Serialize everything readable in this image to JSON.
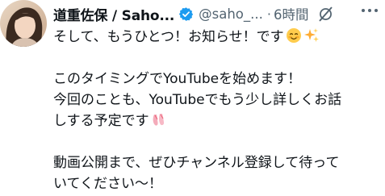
{
  "tweet": {
    "author": {
      "display_name": "道重佐保 / Saho...",
      "handle": "@saho_...",
      "verified_icon": "verified-badge-icon",
      "avatar": "avatar-photo"
    },
    "separator": "·",
    "time": "6時間",
    "icons": {
      "grok": "grok-icon",
      "more": "more-options-icon"
    },
    "lines": {
      "l1": "そして、もうひとつ！お知らせ！です",
      "l3": "このタイミングでYouTubeを始めます！",
      "l4": "今回のことも、YouTubeでもう少し詳しくお話",
      "l5": "しする予定です",
      "l7": "動画公開まで、ぜひチャンネル登録して待って",
      "l8": "いてください〜！"
    },
    "emojis": {
      "l1_a": "smiling-face-icon",
      "l1_b": "sparkles-icon",
      "l5": "ballet-shoes-icon"
    },
    "colors": {
      "text": "#0f1419",
      "secondary": "#536471",
      "verified": "#1d9bf0"
    }
  }
}
